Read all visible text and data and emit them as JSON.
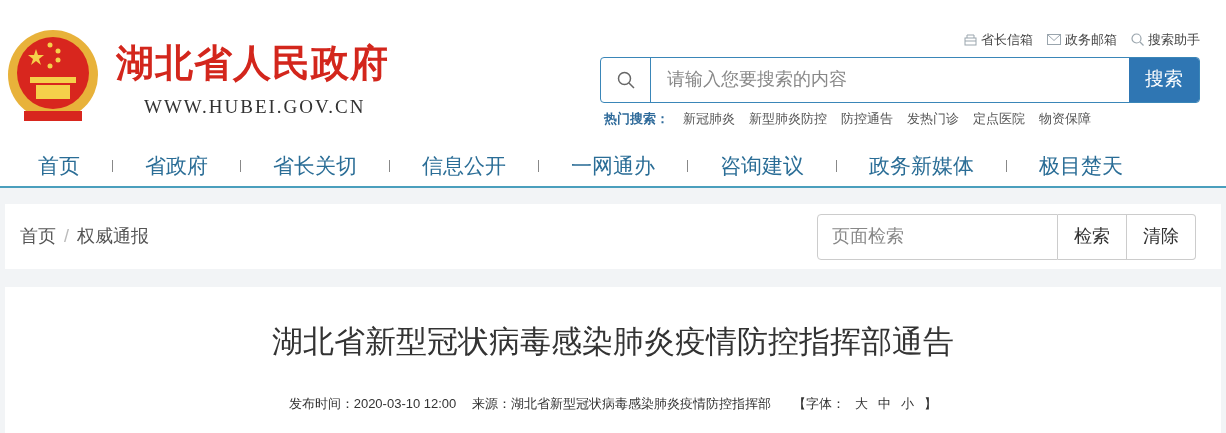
{
  "site": {
    "title": "湖北省人民政府",
    "domain": "WWW.HUBEI.GOV.CN"
  },
  "top_links": [
    {
      "kind": "mailbox",
      "label": "省长信箱"
    },
    {
      "kind": "mail",
      "label": "政务邮箱"
    },
    {
      "kind": "search",
      "label": "搜索助手"
    }
  ],
  "search": {
    "placeholder": "请输入您要搜索的内容",
    "button": "搜索"
  },
  "hot_search": {
    "label": "热门搜索：",
    "items": [
      "新冠肺炎",
      "新型肺炎防控",
      "防控通告",
      "发热门诊",
      "定点医院",
      "物资保障"
    ]
  },
  "nav": [
    "首页",
    "省政府",
    "省长关切",
    "信息公开",
    "一网通办",
    "咨询建议",
    "政务新媒体",
    "极目楚天"
  ],
  "breadcrumb": [
    "首页",
    "权威通报"
  ],
  "breadcrumb_separator": "/",
  "page_search": {
    "placeholder": "页面检索",
    "buttons": [
      "检索",
      "清除"
    ]
  },
  "article": {
    "title": "湖北省新型冠状病毒感染肺炎疫情防控指挥部通告",
    "published": "发布时间：2020-03-10 12:00",
    "source": "来源：湖北省新型冠状病毒感染肺炎疫情防控指挥部",
    "font_open": "【字体：",
    "font_sizes": [
      "大",
      "中",
      "小"
    ],
    "font_close": "】"
  }
}
